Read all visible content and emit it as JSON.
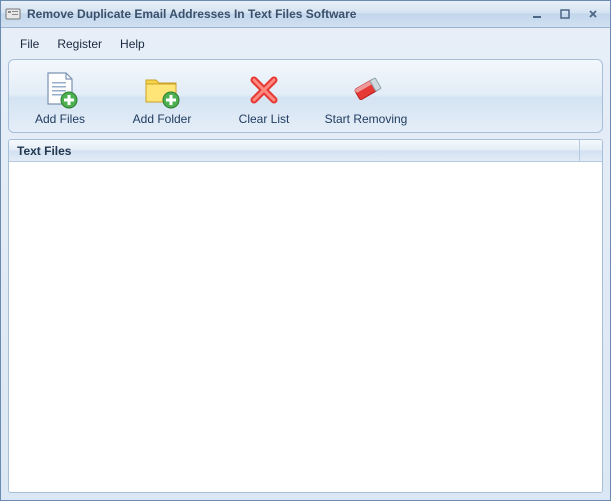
{
  "window": {
    "title": "Remove Duplicate Email Addresses In Text Files Software"
  },
  "menu": {
    "file": "File",
    "register": "Register",
    "help": "Help"
  },
  "toolbar": {
    "add_files": "Add Files",
    "add_folder": "Add Folder",
    "clear_list": "Clear List",
    "start_removing": "Start Removing"
  },
  "list": {
    "column_header": "Text Files",
    "rows": []
  }
}
